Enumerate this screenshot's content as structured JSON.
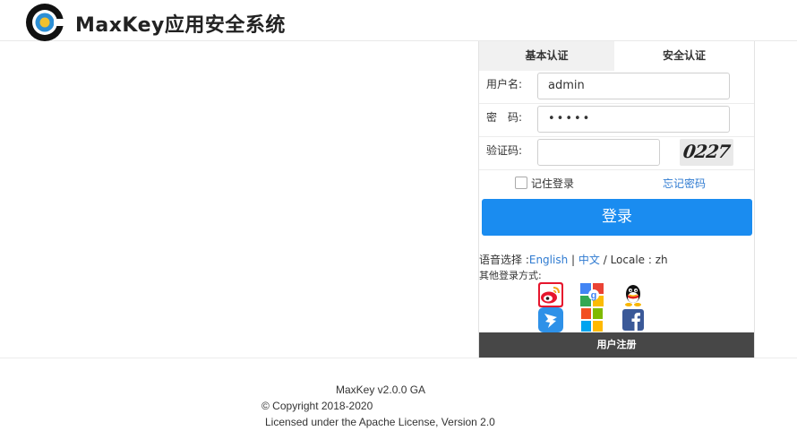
{
  "header": {
    "brand": "MaxKey应用安全系统",
    "logo_icon": "maxkey-logo-icon",
    "brand_color": "#222222",
    "logo_colors": [
      "#111111",
      "#2d8fd5",
      "#f2c12e"
    ]
  },
  "login": {
    "tabs": [
      {
        "label": "基本认证"
      },
      {
        "label": "安全认证"
      }
    ],
    "username_label": "用户名:",
    "username_value": "admin",
    "password_label": "密　码:",
    "password_value": "•••••",
    "captcha_label": "验证码:",
    "captcha_value": "",
    "captcha_text": "0227",
    "remember_label": "记住登录",
    "forgot_label": "忘记密码",
    "login_button": "登录",
    "accent_color": "#1a8cf0"
  },
  "locale": {
    "prefix": "语音选择 :",
    "english": "English",
    "sep": " | ",
    "chinese": "中文",
    "suffix": " / Locale : zh"
  },
  "other_login": {
    "label": "其他登录方式:",
    "providers": [
      "weibo-icon",
      "google-icon",
      "qq-icon",
      "dingtalk-icon",
      "microsoft-icon",
      "facebook-icon"
    ]
  },
  "register": {
    "label": "用户注册"
  },
  "footer": {
    "version": "MaxKey  v2.0.0 GA",
    "copyright": "© Copyright 2018-2020",
    "license": "Licensed under the Apache License, Version 2.0"
  }
}
